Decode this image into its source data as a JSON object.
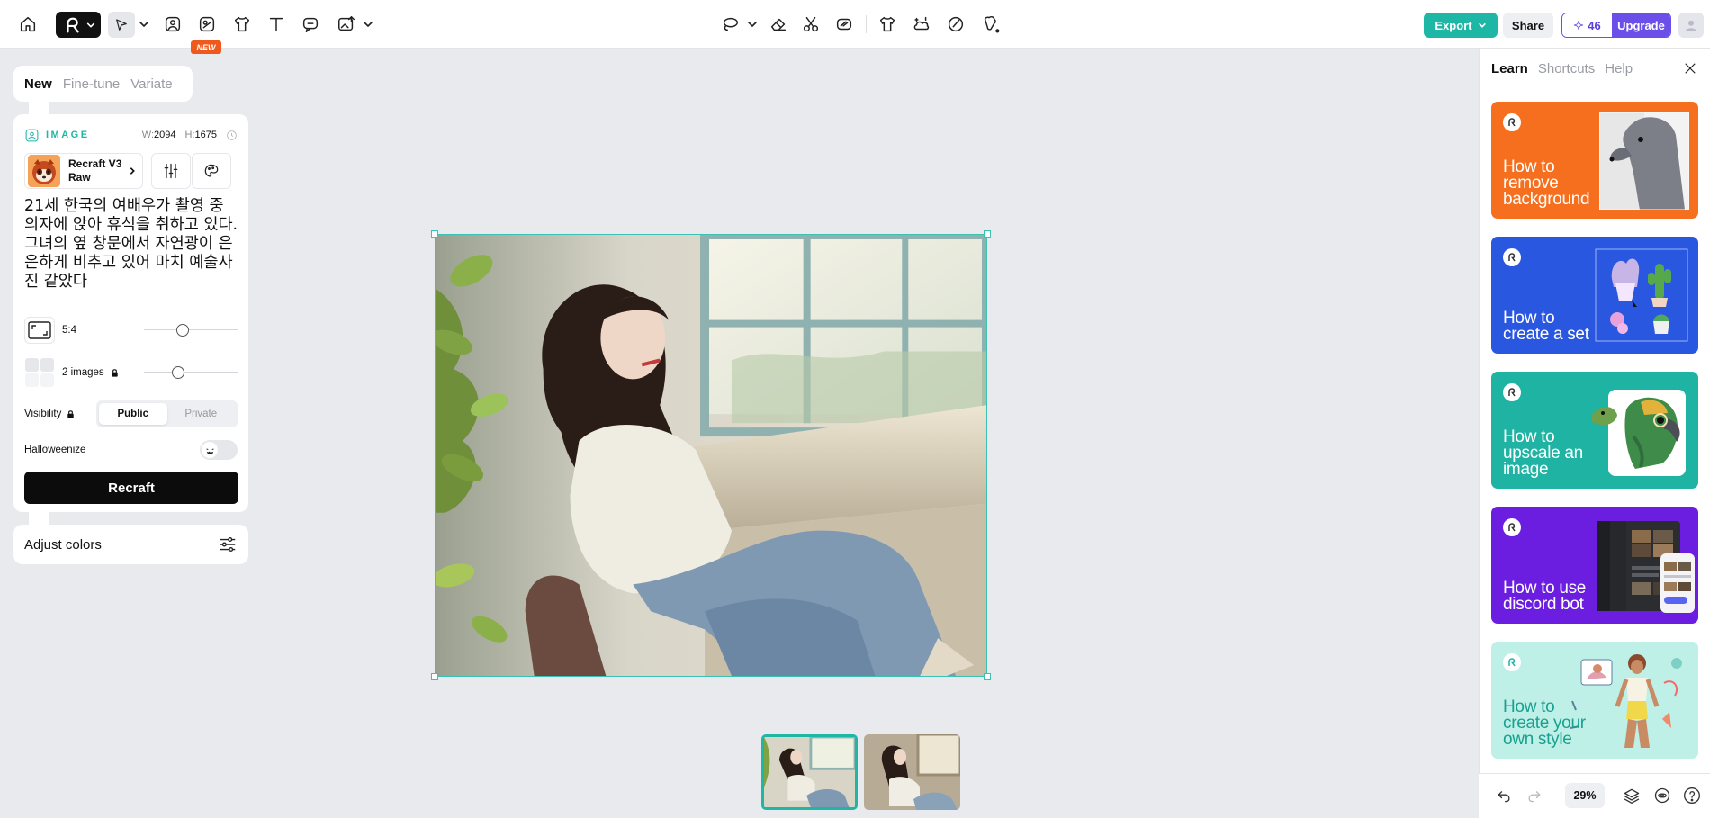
{
  "topbar": {
    "new_badge": "NEW",
    "export_label": "Export",
    "share_label": "Share",
    "credits": "46",
    "upgrade_label": "Upgrade"
  },
  "left_panel": {
    "mode_tabs": [
      {
        "label": "New",
        "active": true
      },
      {
        "label": "Fine-tune",
        "active": false
      },
      {
        "label": "Variate",
        "active": false
      }
    ],
    "image_label": "IMAGE",
    "width_key": "W:",
    "width_value": "2094",
    "height_key": "H:",
    "height_value": "1675",
    "model_name": "Recraft V3 Raw",
    "prompt": "21세 한국의 여배우가 촬영 중 의자에 앉아 휴식을 취하고 있다. 그녀의 옆 창문에서 자연광이 은은하게 비추고 있어 마치 예술사진 같았다",
    "aspect_ratio": "5:4",
    "ratio_slider": 0.4,
    "image_count": "2 images",
    "count_slider": 0.35,
    "visibility_label": "Visibility",
    "visibility_options": [
      "Public",
      "Private"
    ],
    "visibility_selected": "Public",
    "halloweenize_label": "Halloweenize",
    "recraft_label": "Recraft",
    "adjust_colors_label": "Adjust colors"
  },
  "right_panel": {
    "tabs": [
      {
        "label": "Learn",
        "active": true
      },
      {
        "label": "Shortcuts",
        "active": false
      },
      {
        "label": "Help",
        "active": false
      }
    ],
    "cards": [
      {
        "title": "How to remove background",
        "color": "#f56f1e"
      },
      {
        "title": "How to create a set",
        "color": "#2a57e0"
      },
      {
        "title": "How to upscale an image",
        "color": "#1eb3a3"
      },
      {
        "title": "How to use discord bot",
        "color": "#6b1ee0"
      },
      {
        "title": "How to create your own style",
        "color": "#bff0e8"
      }
    ],
    "zoom": "29%"
  },
  "colors": {
    "accent": "#1eb7a5",
    "upgrade": "#6b4fe8",
    "canvas_bg": "#e9eaed"
  }
}
